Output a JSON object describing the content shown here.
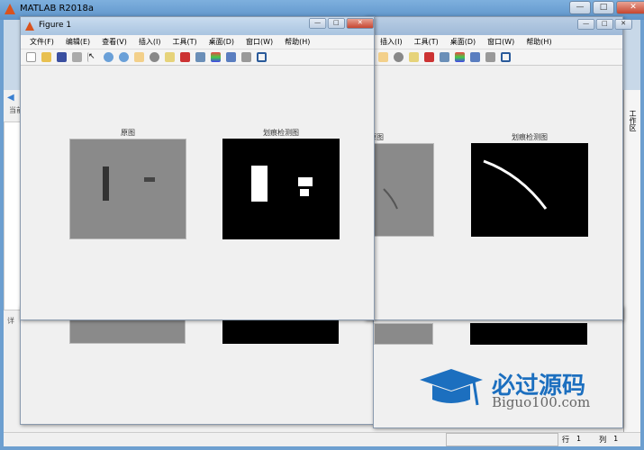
{
  "main_window": {
    "title": "MATLAB R2018a",
    "min": "—",
    "max": "□",
    "close": "✕"
  },
  "left_panel": {
    "current_label": "当前",
    "details_label": "详"
  },
  "right_panel": {
    "workspace_label": "工作区"
  },
  "status_bar": {
    "row_label": "行",
    "row_value": "1",
    "col_label": "列",
    "col_value": "1"
  },
  "figure1": {
    "title": "Figure 1",
    "menus": [
      "文件(F)",
      "编辑(E)",
      "查看(V)",
      "插入(I)",
      "工具(T)",
      "桌面(D)",
      "窗口(W)",
      "帮助(H)"
    ],
    "axes": [
      {
        "title": "原图"
      },
      {
        "title": "划痕检测图"
      }
    ]
  },
  "figure2": {
    "menus": [
      "插入(I)",
      "工具(T)",
      "桌面(D)",
      "窗口(W)",
      "帮助(H)"
    ],
    "axes": [
      {
        "title": "原图"
      },
      {
        "title": "划痕检测图"
      }
    ]
  },
  "toolbar_icons": [
    "new-file",
    "open",
    "save",
    "print",
    "pointer",
    "zoom-in",
    "zoom-out",
    "pan",
    "rotate",
    "data-cursor",
    "brush",
    "link",
    "colorbar",
    "legend",
    "hide-plot",
    "show-plot"
  ],
  "watermark": {
    "cn": "必过源码",
    "en": "Biguo100.com"
  }
}
